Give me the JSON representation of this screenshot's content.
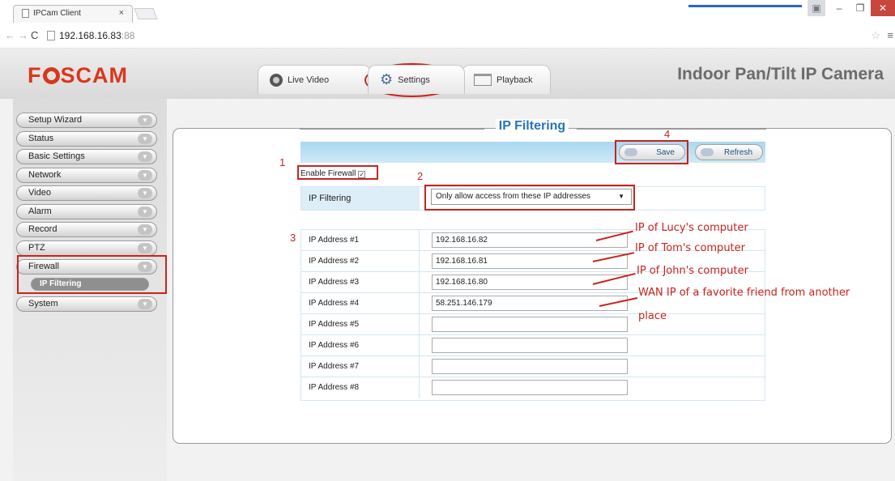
{
  "browser": {
    "tab_title": "IPCam Client",
    "tab_close": "×",
    "url_host": "192.168.16.83",
    "url_port": ":88"
  },
  "header": {
    "logo_pre": "F",
    "logo_post": "SCAM",
    "tabs": [
      {
        "label": "Live Video",
        "icon": "camera-icon"
      },
      {
        "label": "Settings",
        "icon": "gear-icon"
      },
      {
        "label": "Playback",
        "icon": "playback-icon"
      }
    ],
    "camera_title": "Indoor Pan/Tilt IP Camera"
  },
  "sidebar": {
    "items": [
      "Setup Wizard",
      "Status",
      "Basic Settings",
      "Network",
      "Video",
      "Alarm",
      "Record",
      "PTZ",
      "Firewall",
      "System"
    ],
    "active_sub": "IP Filtering"
  },
  "panel": {
    "title": "IP Filtering",
    "save_label": "Save",
    "refresh_label": "Refresh",
    "enable_firewall_label": "Enable Firewall",
    "enable_firewall_checked": true,
    "filter_label": "IP Filtering",
    "filter_selected": "Only allow access from these IP addresses",
    "ip_rows": [
      {
        "label": "IP Address #1",
        "value": "192.168.16.82"
      },
      {
        "label": "IP Address #2",
        "value": "192.168.16.81"
      },
      {
        "label": "IP Address #3",
        "value": "192.168.16.80"
      },
      {
        "label": "IP Address #4",
        "value": "58.251.146.179"
      },
      {
        "label": "IP Address #5",
        "value": ""
      },
      {
        "label": "IP Address #6",
        "value": ""
      },
      {
        "label": "IP Address #7",
        "value": ""
      },
      {
        "label": "IP Address #8",
        "value": ""
      }
    ]
  },
  "annotations": {
    "numbers": [
      "1",
      "2",
      "3",
      "4"
    ],
    "notes": [
      "IP of Lucy's computer",
      "IP of Tom's computer",
      "IP of John's computer",
      "WAN IP of a favorite friend from another",
      "place"
    ],
    "color": "#c8241d"
  }
}
